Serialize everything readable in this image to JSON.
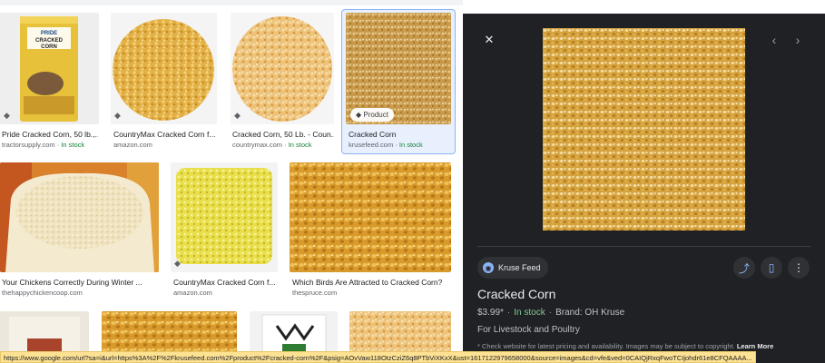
{
  "grid": {
    "row1": [
      {
        "title": "Pride Cracked Corn, 50 lb.,...",
        "source": "tractorsupply.com",
        "stock": "In stock"
      },
      {
        "title": "CountryMax Cracked Corn f...",
        "source": "amazon.com",
        "stock": ""
      },
      {
        "title": "Cracked Corn, 50 Lb. - Coun...",
        "source": "countrymax.com",
        "stock": "In stock"
      },
      {
        "title": "Cracked Corn",
        "source": "krusefeed.com",
        "stock": "In stock",
        "badge": "Product"
      }
    ],
    "row2": [
      {
        "title": "Your Chickens Correctly During Winter ...",
        "source": "thehappychickencoop.com"
      },
      {
        "title": "CountryMax Cracked Corn f...",
        "source": "amazon.com"
      },
      {
        "title": "Which Birds Are Attracted to Cracked Corn?",
        "source": "thespruce.com"
      }
    ],
    "bag_label": {
      "brand": "PRIDE",
      "line1": "CRACKED",
      "line2": "CORN"
    },
    "separator": " · "
  },
  "panel": {
    "close_icon": "close-icon",
    "source_name": "Kruse Feed",
    "title": "Cracked Corn",
    "price": "$3.99*",
    "stock": "In stock",
    "brand": "Brand: OH Kruse",
    "description": "For Livestock and Poultry",
    "disclaimer": "* Check website for latest pricing and availability. Images may be subject to copyright.",
    "learn_more": "Learn More"
  },
  "status_url": "https://www.google.com/url?sa=i&url=https%3A%2F%2Fkrusefeed.com%2Fproduct%2Fcracked-corn%2F&psig=AOvVaw118OtzCziZ6q8PTbViXKxX&ust=1617122979658000&source=images&cd=vfe&ved=0CAIQjRxqFwoTCIjohdr61e8CFQAAAA...",
  "colors": {
    "panel_bg": "#202124",
    "accent": "#8ab4f8",
    "in_stock": "#188038",
    "status_bg": "#fde293"
  }
}
